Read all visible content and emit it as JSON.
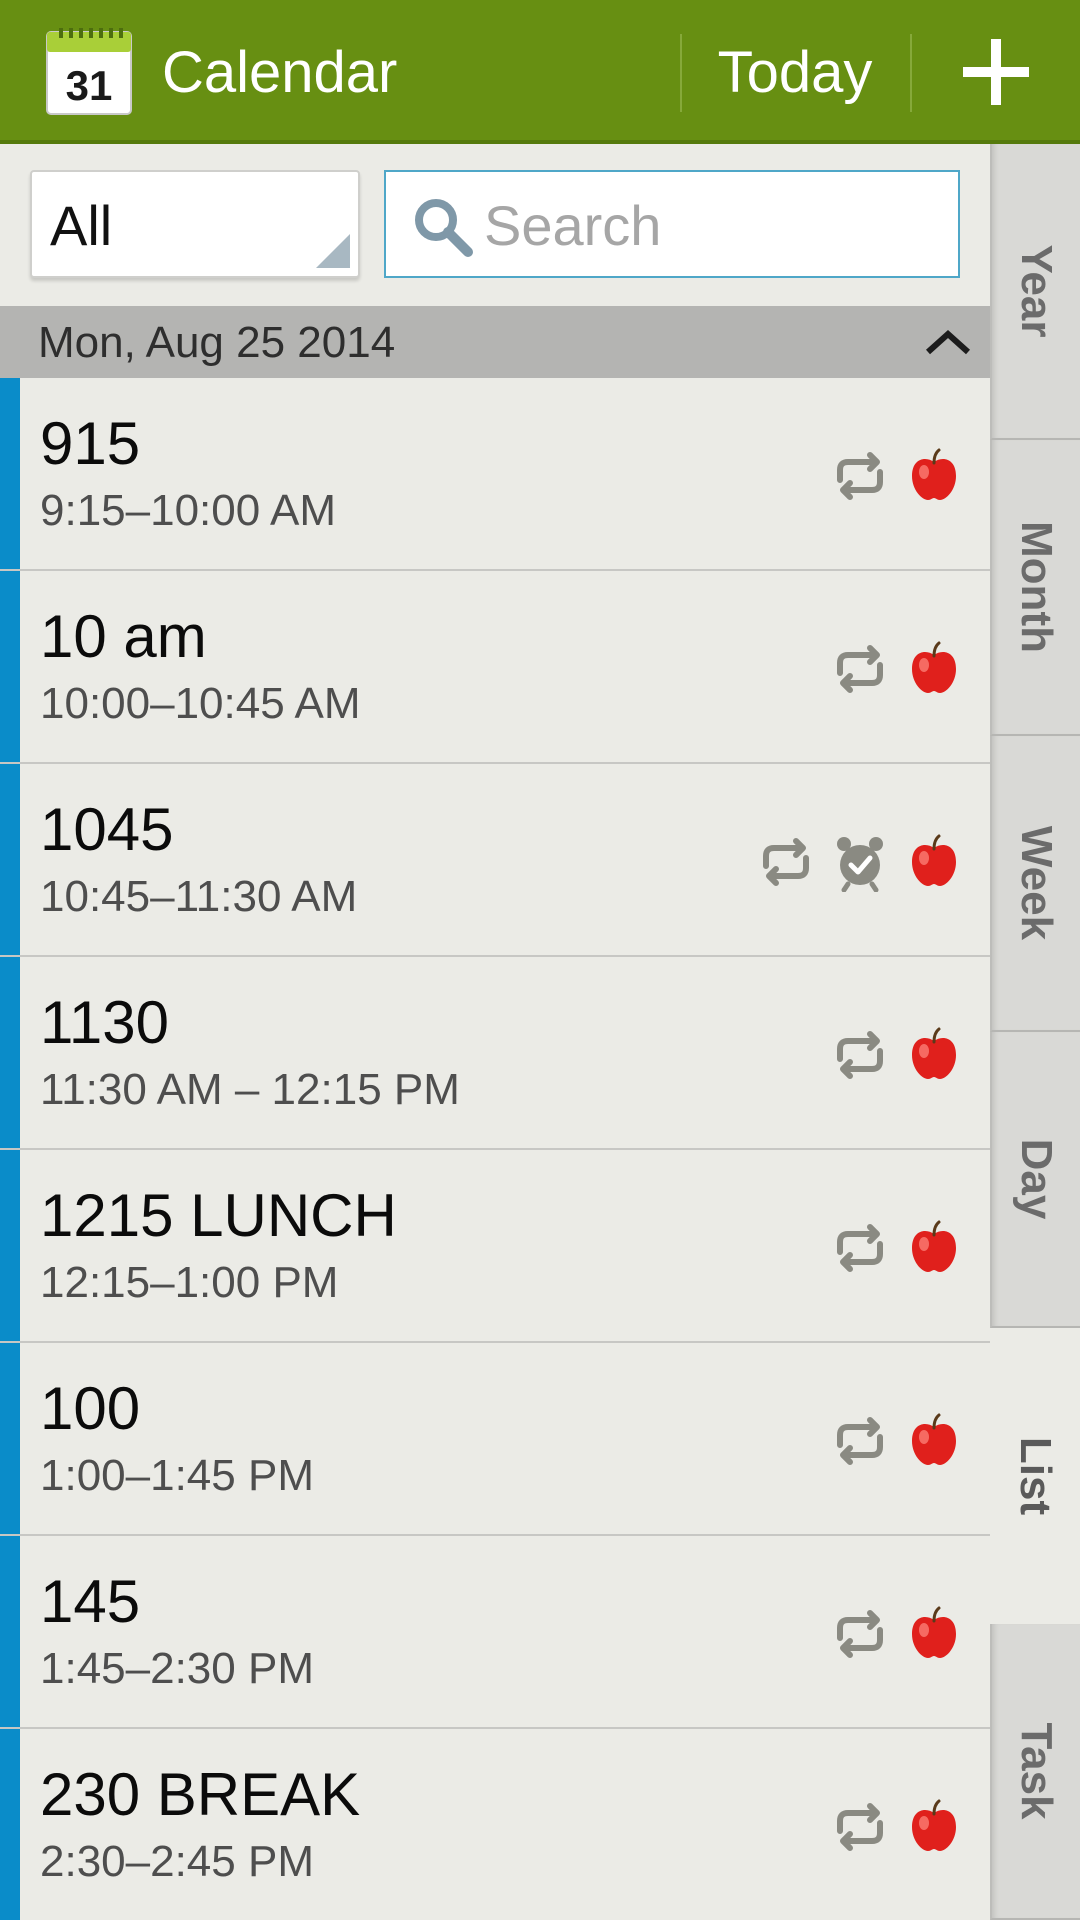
{
  "actionbar": {
    "app_icon_day": "31",
    "title": "Calendar",
    "today_label": "Today",
    "add_icon": "plus-icon"
  },
  "filter": {
    "selected": "All",
    "search_placeholder": "Search",
    "search_value": ""
  },
  "date_header": {
    "label": "Mon, Aug 25 2014"
  },
  "events": [
    {
      "title": "915",
      "time": "9:15–10:00 AM",
      "icons": [
        "repeat-icon",
        "apple-icon"
      ]
    },
    {
      "title": "10 am",
      "time": "10:00–10:45 AM",
      "icons": [
        "repeat-icon",
        "apple-icon"
      ]
    },
    {
      "title": "1045",
      "time": "10:45–11:30 AM",
      "icons": [
        "repeat-icon",
        "alarm-icon",
        "apple-icon"
      ]
    },
    {
      "title": "1130",
      "time": "11:30 AM – 12:15 PM",
      "icons": [
        "repeat-icon",
        "apple-icon"
      ]
    },
    {
      "title": "1215 LUNCH",
      "time": "12:15–1:00 PM",
      "icons": [
        "repeat-icon",
        "apple-icon"
      ]
    },
    {
      "title": "100",
      "time": "1:00–1:45 PM",
      "icons": [
        "repeat-icon",
        "apple-icon"
      ]
    },
    {
      "title": "145",
      "time": "1:45–2:30 PM",
      "icons": [
        "repeat-icon",
        "apple-icon"
      ]
    },
    {
      "title": "230 BREAK",
      "time": "2:30–2:45 PM",
      "icons": [
        "repeat-icon",
        "apple-icon"
      ]
    }
  ],
  "side_tabs": {
    "year": "Year",
    "month": "Month",
    "week": "Week",
    "day": "Day",
    "list": "List",
    "task": "Task",
    "active": "List"
  },
  "colors": {
    "actionbar": "#678f12",
    "event_bar": "#0a8cc9",
    "apple": "#e0201c",
    "icon_gray": "#8a8a82"
  }
}
